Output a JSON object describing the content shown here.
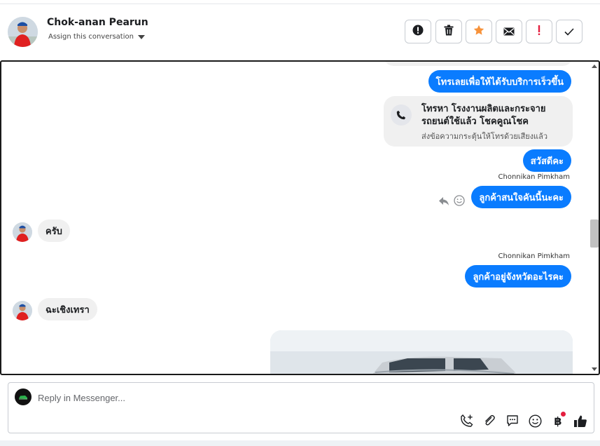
{
  "header": {
    "contact_name": "Chok-anan Pearun",
    "assign_label": "Assign this conversation",
    "toolbar": {
      "spam": "alert-circle-icon",
      "delete": "trash-icon",
      "star": "star-icon",
      "mark_unread": "envelope-icon",
      "important": "exclamation-icon",
      "done": "check-icon"
    }
  },
  "messages": {
    "m1": "โทรเลยเพื่อให้ได้รับบริการเร็วขึ้น",
    "call_card": {
      "title": "โทรหา โรงงานผลิตและกระจาย รถยนต์ใช้แล้ว โชคคูณโชค",
      "subtitle": "ส่งข้อความกระตุ้นให้โทรด้วยเสียงแล้ว"
    },
    "m2": "สวัสดีคะ",
    "sender1": "Chonnikan Pimkham",
    "m3": "ลูกค้าสนใจคันนี้นะคะ",
    "in1": "ครับ",
    "sender2": "Chonnikan Pimkham",
    "m4": "ลูกค้าอยู่จังหวัดอะไรคะ",
    "in2": "ฉะเชิงเทรา"
  },
  "composer": {
    "placeholder": "Reply in Messenger...",
    "icons": [
      "phone-plus-icon",
      "paperclip-icon",
      "saved-reply-icon",
      "emoji-icon",
      "baht-icon",
      "thumbs-up-icon"
    ]
  },
  "colors": {
    "accent": "#0a7cff",
    "star": "#f7923a",
    "important": "#e41e3f",
    "notification_dot": "#e41e3f"
  }
}
